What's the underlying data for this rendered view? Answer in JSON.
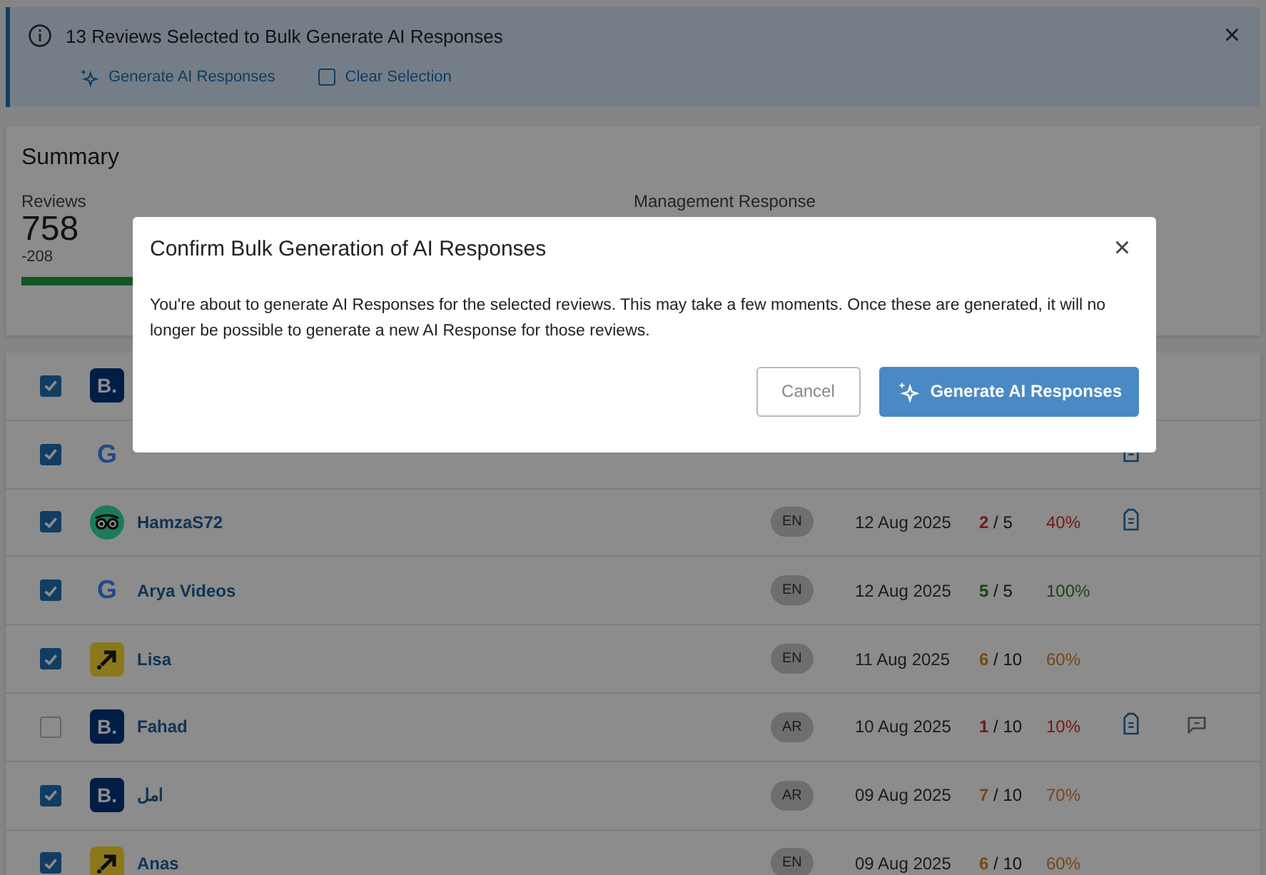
{
  "banner": {
    "title": "13 Reviews Selected to Bulk Generate AI Responses",
    "actions": [
      {
        "kind": "sparkle",
        "label": "Generate AI Responses"
      },
      {
        "kind": "checkbox",
        "label": "Clear Selection"
      }
    ],
    "close": "×"
  },
  "summary": {
    "title": "Summary",
    "reviews_label": "Reviews",
    "reviews_value": "758",
    "reviews_change": "-208",
    "reviews_bar": {
      "level": 0.4
    },
    "management_label": "Management Response"
  },
  "rows": [
    {
      "checked": true,
      "logo": {
        "kind": "booking",
        "text": "B."
      }
    },
    {
      "checked": true,
      "logo": {
        "kind": "google",
        "text": "G"
      },
      "note": true
    },
    {
      "checked": true,
      "logo": {
        "kind": "owl"
      },
      "name": "HamzaS72",
      "lang": "EN",
      "date": "12 Aug 2025",
      "rating": {
        "kind": "low",
        "score": "2",
        "out_of": " / 5",
        "percent": "40%"
      },
      "note": true,
      "reply": false
    },
    {
      "checked": true,
      "logo": {
        "kind": "google",
        "text": "G"
      },
      "name": "Arya Videos",
      "lang": "EN",
      "date": "12 Aug 2025",
      "rating": {
        "kind": "high",
        "score": "5",
        "out_of": " / 5",
        "percent": "100%"
      },
      "note": false,
      "reply": false
    },
    {
      "checked": true,
      "logo": {
        "kind": "arrow"
      },
      "name": "Lisa",
      "lang": "EN",
      "date": "11 Aug 2025",
      "rating": {
        "kind": "mid",
        "score": "6",
        "out_of": " / 10",
        "percent": "60%"
      },
      "note": false,
      "reply": false
    },
    {
      "checked": false,
      "logo": {
        "kind": "booking",
        "text": "B."
      },
      "name": "Fahad",
      "lang": "AR",
      "date": "10 Aug 2025",
      "rating": {
        "kind": "low",
        "score": "1",
        "out_of": " / 10",
        "percent": "10%"
      },
      "note": true,
      "reply": true
    },
    {
      "checked": true,
      "logo": {
        "kind": "booking",
        "text": "B."
      },
      "name": "امل",
      "lang": "AR",
      "date": "09 Aug 2025",
      "rating": {
        "kind": "mid",
        "score": "7",
        "out_of": " / 10",
        "percent": "70%"
      },
      "note": false,
      "reply": false
    },
    {
      "checked": true,
      "logo": {
        "kind": "arrow"
      },
      "name": "Anas",
      "lang": "EN",
      "date": "09 Aug 2025",
      "rating": {
        "kind": "mid",
        "score": "6",
        "out_of": " / 10",
        "percent": "60%"
      },
      "note": false,
      "reply": false
    }
  ],
  "dialog": {
    "title": "Confirm Bulk Generation of AI Responses",
    "close": "×",
    "message": "You're about to generate AI Responses for the selected reviews. This may take a few moments. Once these are generated, it will no longer be possible to generate a new AI Response for those reviews.",
    "cancel": "Cancel",
    "confirm": "Generate AI Responses"
  }
}
